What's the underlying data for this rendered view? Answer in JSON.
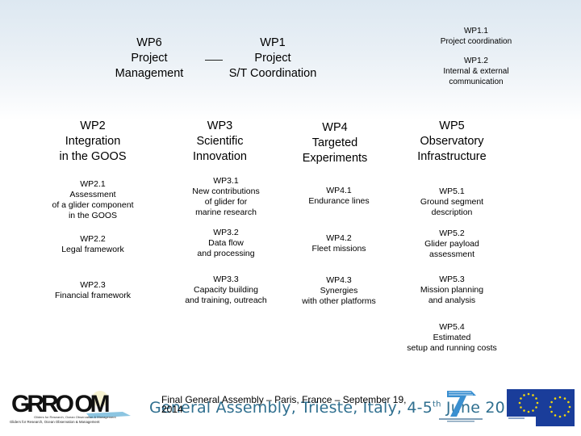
{
  "top": {
    "wp6": {
      "code": "WP6",
      "line1": "Project",
      "line2": "Management"
    },
    "wp1": {
      "code": "WP1",
      "line1": "Project",
      "line2": "S/T Coordination"
    },
    "wp1_tasks": [
      {
        "code": "WP1.1",
        "lines": [
          "Project coordination"
        ]
      },
      {
        "code": "WP1.2",
        "lines": [
          "Internal & external",
          "communication"
        ]
      }
    ]
  },
  "work_packages": [
    {
      "code": "WP2",
      "title_lines": [
        "Integration",
        "in the GOOS"
      ],
      "tasks": [
        {
          "code": "WP2.1",
          "lines": [
            "Assessment",
            "of a glider component",
            "in the GOOS"
          ]
        },
        {
          "code": "WP2.2",
          "lines": [
            "Legal framework"
          ]
        },
        {
          "code": "WP2.3",
          "lines": [
            "Financial framework"
          ]
        }
      ]
    },
    {
      "code": "WP3",
      "title_lines": [
        "Scientific",
        "Innovation"
      ],
      "tasks": [
        {
          "code": "WP3.1",
          "lines": [
            "New contributions",
            "of glider for",
            "marine research"
          ]
        },
        {
          "code": "WP3.2",
          "lines": [
            "Data flow",
            "and processing"
          ]
        },
        {
          "code": "WP3.3",
          "lines": [
            "Capacity building",
            "and training, outreach"
          ]
        }
      ]
    },
    {
      "code": "WP4",
      "title_lines": [
        "Targeted",
        "Experiments"
      ],
      "tasks": [
        {
          "code": "WP4.1",
          "lines": [
            "Endurance lines"
          ]
        },
        {
          "code": "WP4.2",
          "lines": [
            "Fleet missions"
          ]
        },
        {
          "code": "WP4.3",
          "lines": [
            "Synergies",
            "with other platforms"
          ]
        }
      ]
    },
    {
      "code": "WP5",
      "title_lines": [
        "Observatory",
        "Infrastructure"
      ],
      "tasks": [
        {
          "code": "WP5.1",
          "lines": [
            "Ground segment",
            "description"
          ]
        },
        {
          "code": "WP5.2",
          "lines": [
            "Glider payload",
            "assessment"
          ]
        },
        {
          "code": "WP5.3",
          "lines": [
            "Mission planning",
            "and analysis"
          ]
        },
        {
          "code": "WP5.4",
          "lines": [
            "Estimated",
            "setup and running costs"
          ]
        }
      ]
    }
  ],
  "footer": {
    "background_text": "General Assembly, Trieste, Italy, 4-5",
    "background_sup": "th",
    "background_text_end": " June 2013",
    "overlay_line1": "Final General Assembly – Paris, France – September 19,",
    "overlay_line2": "2014",
    "groom_logo_text": "GROOM",
    "groom_tagline": "Gliders for Research, Ocean Observation & Management",
    "fp7_label": "7",
    "colors": {
      "footer_blue": "#2f6f8f",
      "eu_blue": "#1a3d9a",
      "eu_star": "#f5d90a"
    }
  }
}
